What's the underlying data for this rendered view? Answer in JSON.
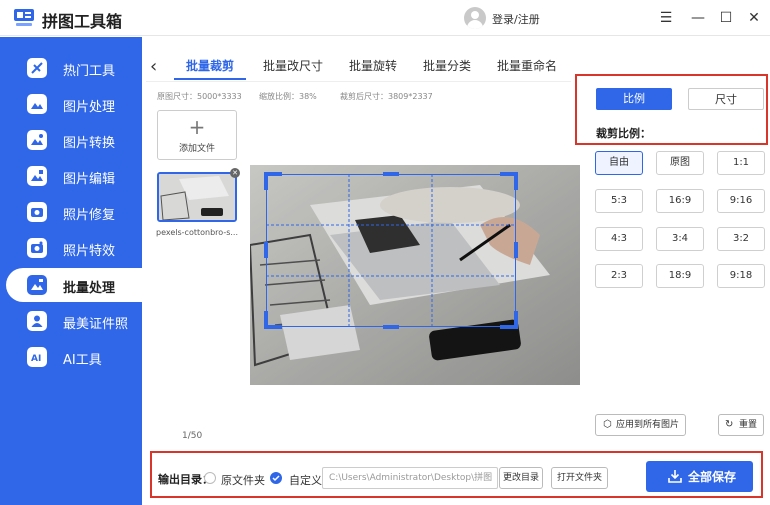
{
  "app": {
    "title": "拼图工具箱",
    "login": "登录/注册"
  },
  "window_controls": {
    "menu": "☰",
    "minimize": "—",
    "maximize": "☐",
    "close": "✕"
  },
  "sidebar": {
    "items": [
      {
        "label": "热门工具",
        "icon": "hot-tools-icon"
      },
      {
        "label": "图片处理",
        "icon": "image-process-icon"
      },
      {
        "label": "图片转换",
        "icon": "image-convert-icon"
      },
      {
        "label": "图片编辑",
        "icon": "image-edit-icon"
      },
      {
        "label": "照片修复",
        "icon": "photo-repair-icon"
      },
      {
        "label": "照片特效",
        "icon": "photo-effects-icon"
      },
      {
        "label": "批量处理",
        "icon": "batch-process-icon",
        "active": true
      },
      {
        "label": "最美证件照",
        "icon": "id-photo-icon"
      },
      {
        "label": "AI工具",
        "icon": "ai-tools-icon"
      }
    ]
  },
  "tabs": [
    {
      "label": "批量裁剪",
      "active": true
    },
    {
      "label": "批量改尺寸"
    },
    {
      "label": "批量旋转"
    },
    {
      "label": "批量分类"
    },
    {
      "label": "批量重命名"
    }
  ],
  "info": {
    "original_size": "原图尺寸：5000*3333",
    "scale": "缩放比例：38%",
    "cropped_size": "裁剪后尺寸：3809*2337"
  },
  "files": {
    "add_label": "添加文件",
    "thumb_name": "pexels-cottonbro-s...",
    "page_count": "1/50"
  },
  "panel": {
    "mode_ratio": "比例",
    "mode_size": "尺寸",
    "crop_ratio_label": "裁剪比例：",
    "ratios": [
      "自由",
      "原图",
      "1:1",
      "5:3",
      "16:9",
      "9:16",
      "4:3",
      "3:4",
      "3:2",
      "2:3",
      "18:9",
      "9:18"
    ],
    "apply_all": "应用到所有图片",
    "reset": "重置"
  },
  "output": {
    "label": "输出目录：",
    "opt_original": "原文件夹",
    "opt_custom": "自定义",
    "path": "C:\\Users\\Administrator\\Desktop\\拼图",
    "change_dir": "更改目录",
    "open_folder": "打开文件夹",
    "save_all": "全部保存"
  },
  "colors": {
    "accent": "#2f67e8",
    "highlight": "#d9362b"
  }
}
